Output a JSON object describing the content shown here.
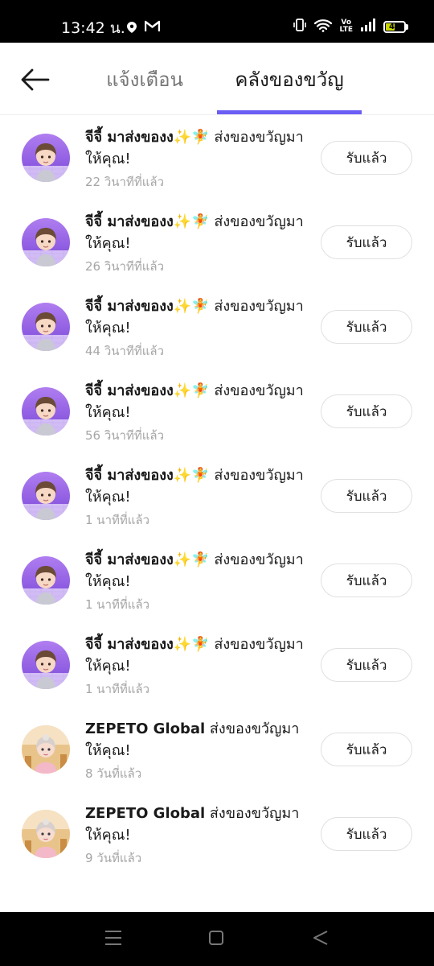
{
  "status_bar": {
    "time": "13:42 น.",
    "volte_line1": "Vo",
    "volte_line2": "LTE",
    "battery": "47"
  },
  "header": {
    "tabs": [
      {
        "label": "แจ้งเตือน",
        "active": false
      },
      {
        "label": "คลังของขวัญ",
        "active": true
      }
    ],
    "accent_color": "#6b5ef5"
  },
  "gifts": [
    {
      "sender": "จีจี้ มาส่งของง✨🧚",
      "message": " ส่งของขวัญมาให้คุณ!",
      "time": "22 วินาทีที่แล้ว",
      "button": "รับแล้ว",
      "avatar": "purple-boy"
    },
    {
      "sender": "จีจี้ มาส่งของง✨🧚",
      "message": " ส่งของขวัญมาให้คุณ!",
      "time": "26 วินาทีที่แล้ว",
      "button": "รับแล้ว",
      "avatar": "purple-boy"
    },
    {
      "sender": "จีจี้ มาส่งของง✨🧚",
      "message": " ส่งของขวัญมาให้คุณ!",
      "time": "44 วินาทีที่แล้ว",
      "button": "รับแล้ว",
      "avatar": "purple-boy"
    },
    {
      "sender": "จีจี้ มาส่งของง✨🧚",
      "message": " ส่งของขวัญมาให้คุณ!",
      "time": "56 วินาทีที่แล้ว",
      "button": "รับแล้ว",
      "avatar": "purple-boy"
    },
    {
      "sender": "จีจี้ มาส่งของง✨🧚",
      "message": " ส่งของขวัญมาให้คุณ!",
      "time": "1 นาทีที่แล้ว",
      "button": "รับแล้ว",
      "avatar": "purple-boy"
    },
    {
      "sender": "จีจี้ มาส่งของง✨🧚",
      "message": " ส่งของขวัญมาให้คุณ!",
      "time": "1 นาทีที่แล้ว",
      "button": "รับแล้ว",
      "avatar": "purple-boy"
    },
    {
      "sender": "จีจี้ มาส่งของง✨🧚",
      "message": " ส่งของขวัญมาให้คุณ!",
      "time": "1 นาทีที่แล้ว",
      "button": "รับแล้ว",
      "avatar": "purple-boy"
    },
    {
      "sender": "ZEPETO Global",
      "message": " ส่งของขวัญมาให้คุณ!",
      "time": "8 วันที่แล้ว",
      "button": "รับแล้ว",
      "avatar": "zepeto-girl"
    },
    {
      "sender": "ZEPETO Global",
      "message": " ส่งของขวัญมาให้คุณ!",
      "time": "9 วันที่แล้ว",
      "button": "รับแล้ว",
      "avatar": "zepeto-girl"
    }
  ],
  "nav": {
    "icons": [
      "menu-icon",
      "home-square-icon",
      "back-triangle-icon"
    ]
  }
}
